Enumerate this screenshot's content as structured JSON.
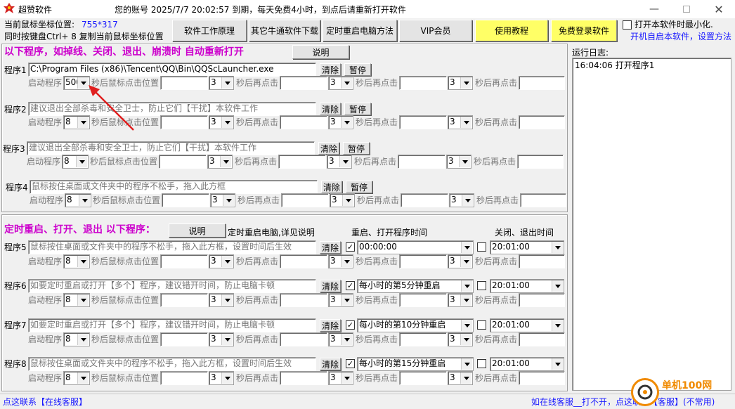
{
  "app": {
    "title": "超赞软件",
    "account_info": "您的账号 2025/7/7 20:02:57 到期，每天免费4小时，到点后请重新打开软件"
  },
  "header": {
    "mouse_pos_label": "当前鼠标坐标位置:",
    "mouse_pos_value": "755*317",
    "hotkey_hint": "同时按键盘Ctrl+ 8 复制当前鼠标坐标位置",
    "btn_principle": "软件工作原理",
    "btn_other_download": "其它牛通软件下载",
    "btn_timed_restart": "定时重启电脑方法",
    "btn_vip": "VIP会员",
    "btn_tutorial": "使用教程",
    "btn_free_login": "免费登录软件",
    "minimize_label": "打开本软件时最小化.",
    "autostart_link": "开机自启本软件，设置方法"
  },
  "section1": {
    "title": "以下程序，如掉线、关闭、退出、崩溃时 自动重新打开",
    "explain": "说明"
  },
  "section2": {
    "title": "定时重启、打开、退出 以下程序：",
    "explain": "说明",
    "restart_note": "定时重启电脑,详见说明",
    "col_restart": "重启、打开程序时间",
    "col_close": "关闭、退出时间"
  },
  "labels": {
    "start_program": "启动程序",
    "click_pos": "秒后鼠标点击位置",
    "click_again": "秒后再点击",
    "clear": "清除",
    "pause": "暂停"
  },
  "programs": [
    {
      "label": "程序1",
      "path": "C:\\Program Files (x86)\\Tencent\\QQ\\Bin\\QQScLauncher.exe",
      "delay": "500",
      "r1": "3",
      "r2": "3",
      "r3": "3"
    },
    {
      "label": "程序2",
      "path": "建议退出全部杀毒和安全卫士，防止它们【干扰】本软件工作",
      "delay": "8",
      "r1": "3",
      "r2": "3",
      "r3": "3"
    },
    {
      "label": "程序3",
      "path": "建议退出全部杀毒和安全卫士，防止它们【干扰】本软件工作",
      "delay": "8",
      "r1": "3",
      "r2": "3",
      "r3": "3"
    },
    {
      "label": "程序4",
      "path": "鼠标按住桌面或文件夹中的程序不松手，拖入此方框",
      "delay": "8",
      "r1": "3",
      "r2": "3",
      "r3": "3"
    }
  ],
  "timed_programs": [
    {
      "label": "程序5",
      "path": "鼠标按住桌面或文件夹中的程序不松手，拖入此方框，设置时间后生效",
      "delay": "8",
      "r1": "3",
      "r2": "3",
      "r3": "3",
      "restart_checked": true,
      "restart_time": "00:00:00",
      "close_checked": false,
      "close_time": "20:01:00"
    },
    {
      "label": "程序6",
      "path": "如要定时重启或打开【多个】程序，建议错开时间，防止电脑卡顿",
      "delay": "8",
      "r1": "3",
      "r2": "3",
      "r3": "3",
      "restart_checked": true,
      "restart_time": "每小时的第5分钟重启",
      "close_checked": false,
      "close_time": "20:01:00"
    },
    {
      "label": "程序7",
      "path": "如要定时重启或打开【多个】程序，建议错开时间，防止电脑卡顿",
      "delay": "8",
      "r1": "3",
      "r2": "3",
      "r3": "3",
      "restart_checked": true,
      "restart_time": "每小时的第10分钟重启",
      "close_checked": false,
      "close_time": "20:01:00"
    },
    {
      "label": "程序8",
      "path": "鼠标按住桌面或文件夹中的程序不松手，拖入此方框，设置时间后生效",
      "delay": "8",
      "r1": "3",
      "r2": "3",
      "r3": "3",
      "restart_checked": true,
      "restart_time": "每小时的第15分钟重启",
      "close_checked": false,
      "close_time": "20:01:00"
    }
  ],
  "log": {
    "title": "运行日志:",
    "entries": [
      "16:04:06 打开程序1"
    ]
  },
  "statusbar": {
    "left": "点这联系【在线客服】",
    "right": "如在线客服__打不开，点这联系【客服】(不常用)",
    "watermark": "单机100网"
  },
  "colors": {
    "accent_magenta": "#cc00cc",
    "link_blue": "#1a1aff",
    "tutorial_yellow": "#ffff66",
    "arrow_red": "#e02020"
  }
}
